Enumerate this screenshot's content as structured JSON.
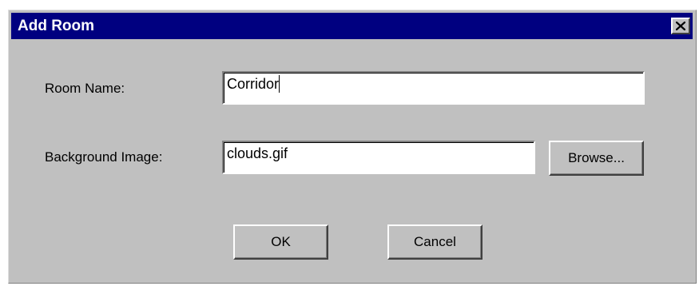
{
  "window": {
    "title": "Add Room",
    "close_icon": "close-icon"
  },
  "form": {
    "room_name_label": "Room Name:",
    "room_name_value": "Corridor",
    "background_label": "Background Image:",
    "background_value": "clouds.gif",
    "browse_label": "Browse..."
  },
  "buttons": {
    "ok_label": "OK",
    "cancel_label": "Cancel"
  },
  "colors": {
    "titlebar": "#000080",
    "dialog_bg": "#c0c0c0"
  }
}
